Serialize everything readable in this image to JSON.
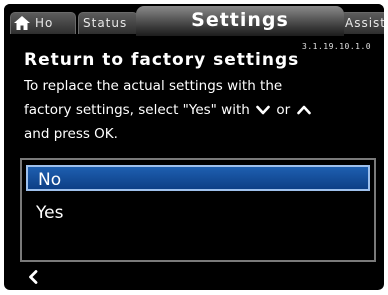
{
  "tabs": {
    "home_label": "Ho",
    "status_label": "Status",
    "settings_label": "Settings",
    "assist_label": "Assist"
  },
  "version": "3.1.19.10.1.0",
  "dialog": {
    "title": "Return to factory settings",
    "line1": "To replace the actual settings with the",
    "line2_prefix": "factory settings, select \"Yes\" with",
    "line2_or": "or",
    "line3": "and press OK."
  },
  "options": {
    "selected": "No",
    "items": [
      "No",
      "Yes"
    ]
  },
  "icons": {
    "home": "home-icon",
    "chevron_down": "chevron-down-icon",
    "chevron_up": "chevron-up-icon",
    "back": "back-arrow-icon"
  },
  "colors": {
    "background": "#000000",
    "selection": "#1e5fb0",
    "selection_border": "#9ec0ec"
  }
}
